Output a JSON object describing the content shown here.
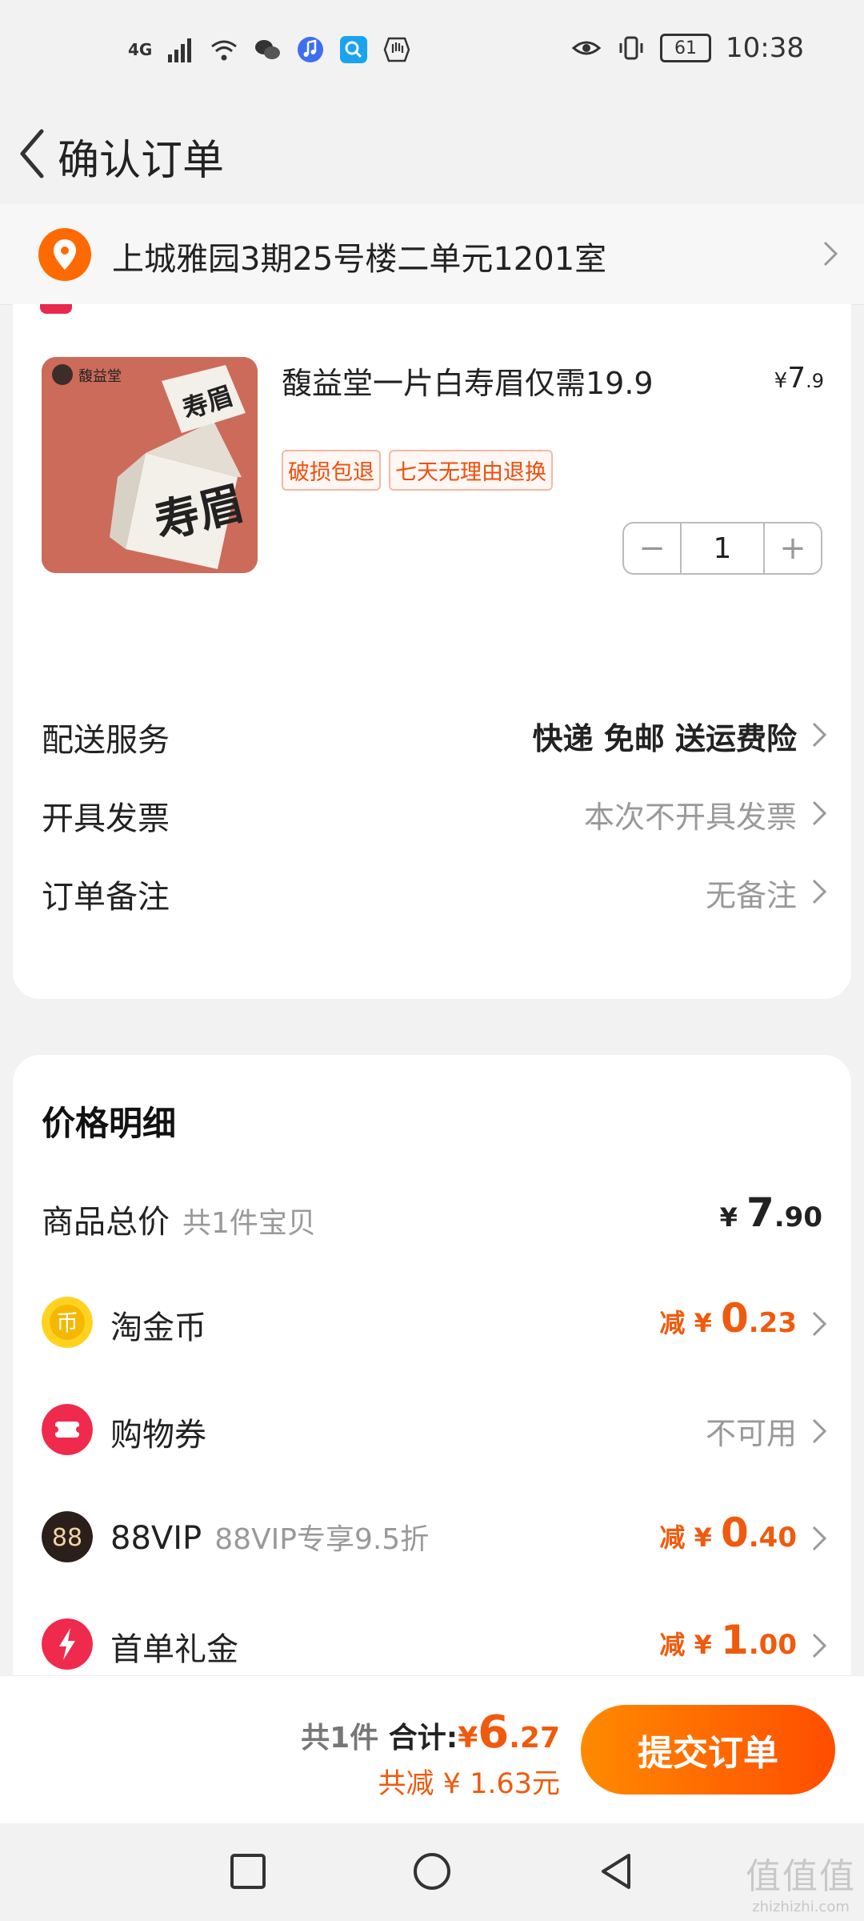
{
  "status_bar": {
    "network": "4G",
    "battery": "61",
    "time": "10:38"
  },
  "header": {
    "title": "确认订单"
  },
  "address": {
    "text": "上城雅园3期25号楼二单元1201室"
  },
  "product": {
    "brand": "馥益堂",
    "box_text": "寿眉",
    "name": "馥益堂一片白寿眉仅需19.9",
    "price_symbol": "¥",
    "price_int": "7",
    "price_dec": ".9",
    "tags": [
      "破损包退",
      "七天无理由退换"
    ],
    "quantity": "1"
  },
  "order_rows": [
    {
      "label": "配送服务",
      "value": "快递 免邮 送运费险"
    },
    {
      "label": "开具发票",
      "value": "本次不开具发票"
    },
    {
      "label": "订单备注",
      "value": "无备注"
    }
  ],
  "price_detail": {
    "title": "价格明细",
    "total": {
      "label": "商品总价",
      "sub": "共1件宝贝",
      "symbol": "¥",
      "int": "7",
      "dec": ".90"
    },
    "rows": [
      {
        "icon": "gold-coin-icon",
        "label": "淘金币",
        "sub": "",
        "prefix": "减",
        "symbol": "¥",
        "int": "0",
        "dec": ".23"
      },
      {
        "icon": "coupon-ticket-icon",
        "label": "购物券",
        "sub": "",
        "value": "不可用"
      },
      {
        "icon": "vip88-icon",
        "label": "88VIP",
        "sub": "88VIP专享9.5折",
        "prefix": "减",
        "symbol": "¥",
        "int": "0",
        "dec": ".40"
      },
      {
        "icon": "lightning-icon",
        "label": "首单礼金",
        "sub": "",
        "prefix": "减",
        "symbol": "¥",
        "int": "1",
        "dec": ".00"
      }
    ]
  },
  "bottom_bar": {
    "count": "共1件",
    "total_label": "合计:",
    "total_symbol": "¥",
    "total_int": "6",
    "total_dec": ".27",
    "saved": "共减 ¥ 1.63元",
    "submit": "提交订单"
  },
  "watermark": {
    "text": "值值值",
    "url": "zhizhizhi.com"
  },
  "colors": {
    "accent": "#f05a0e",
    "submit_gradient_start": "#ff8a00",
    "submit_gradient_end": "#ff4d00",
    "tag_text": "#f04e0e"
  }
}
